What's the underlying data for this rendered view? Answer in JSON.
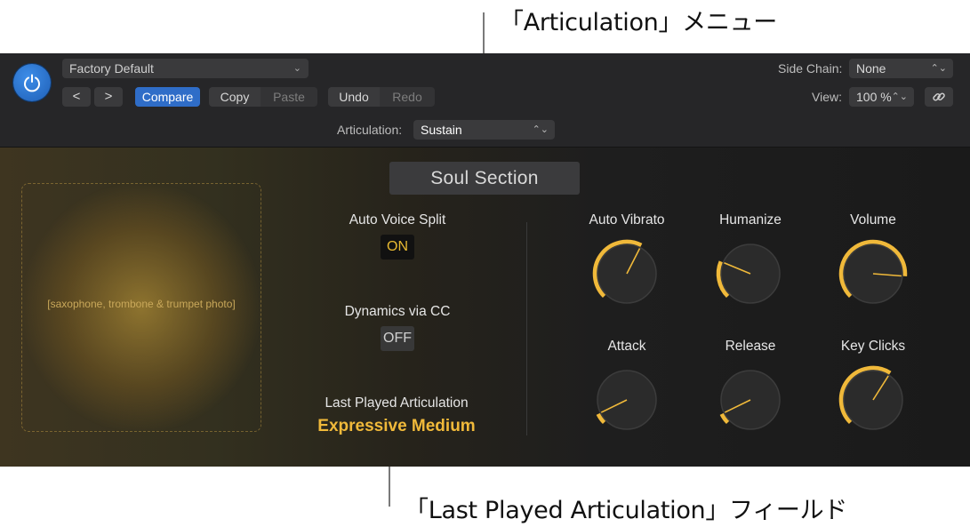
{
  "callouts": {
    "articulation_menu": "「Articulation」メニュー",
    "last_played_field": "「Last Played Articulation」フィールド"
  },
  "header": {
    "preset": "Factory Default",
    "prev": "<",
    "next": ">",
    "compare": "Compare",
    "copy": "Copy",
    "paste": "Paste",
    "undo": "Undo",
    "redo": "Redo",
    "side_chain_label": "Side Chain:",
    "side_chain_value": "None",
    "view_label": "View:",
    "view_value": "100 %",
    "articulation_label": "Articulation:",
    "articulation_value": "Sustain"
  },
  "main": {
    "title": "Soul Section",
    "auto_voice_split_label": "Auto Voice Split",
    "auto_voice_split_value": "ON",
    "dynamics_label": "Dynamics via CC",
    "dynamics_value": "OFF",
    "last_played_label": "Last Played Articulation",
    "last_played_value": "Expressive Medium"
  },
  "knobs": [
    {
      "label": "Auto Vibrato",
      "value": 0.6
    },
    {
      "label": "Humanize",
      "value": 0.25
    },
    {
      "label": "Volume",
      "value": 0.85
    },
    {
      "label": "Attack",
      "value": 0.07
    },
    {
      "label": "Release",
      "value": 0.07
    },
    {
      "label": "Key Clicks",
      "value": 0.62
    }
  ],
  "colors": {
    "accent": "#f0b93a",
    "knob_track": "#2b2b2b",
    "compare_blue": "#2f6dc8"
  }
}
